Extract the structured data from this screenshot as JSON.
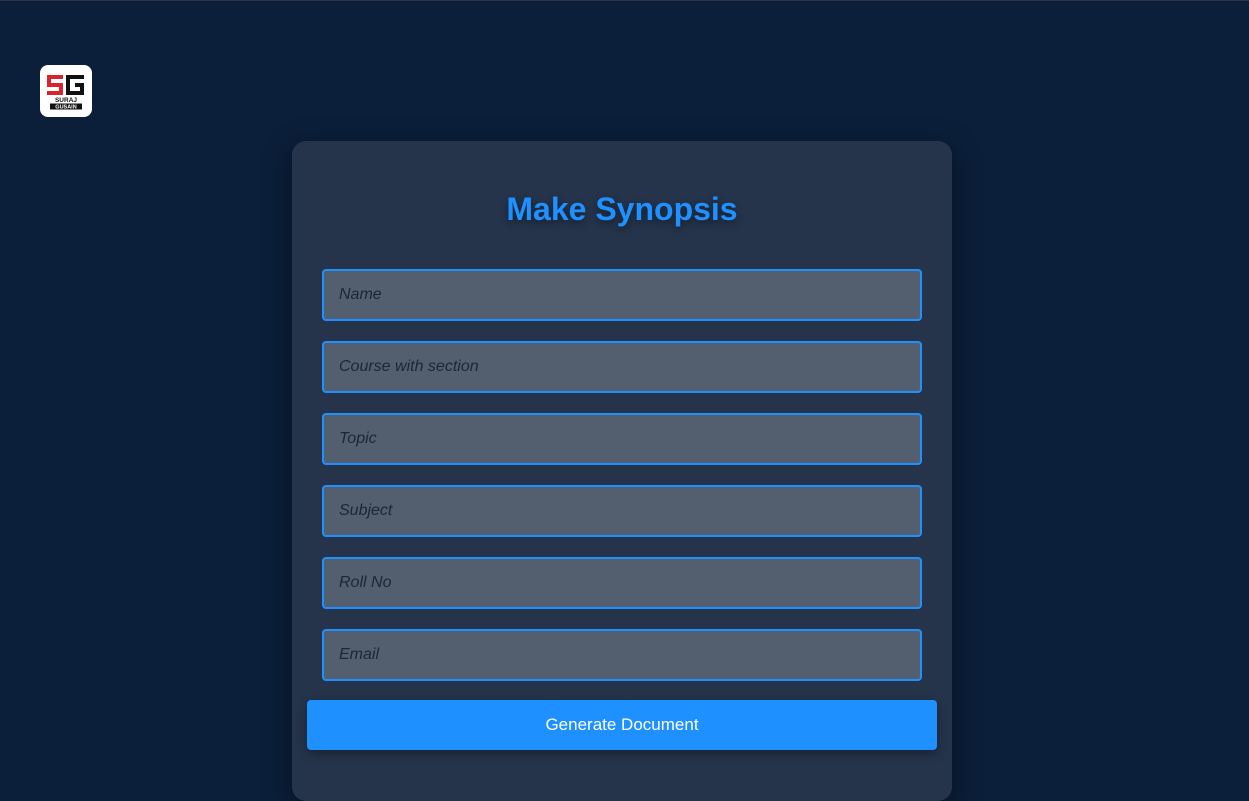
{
  "logo": {
    "mark": "SG",
    "line1": "SURAJ",
    "line2": "GUSAIN",
    "accent_color": "#d7262b"
  },
  "form": {
    "title": "Make Synopsis",
    "fields": [
      {
        "placeholder": "Name",
        "value": ""
      },
      {
        "placeholder": "Course with section",
        "value": ""
      },
      {
        "placeholder": "Topic",
        "value": ""
      },
      {
        "placeholder": "Subject",
        "value": ""
      },
      {
        "placeholder": "Roll No",
        "value": ""
      },
      {
        "placeholder": "Email",
        "value": ""
      }
    ],
    "submit_label": "Generate Document"
  },
  "colors": {
    "background": "#0b1f3a",
    "card": "#25344b",
    "accent": "#1e90ff",
    "input_bg": "#535f6e"
  }
}
